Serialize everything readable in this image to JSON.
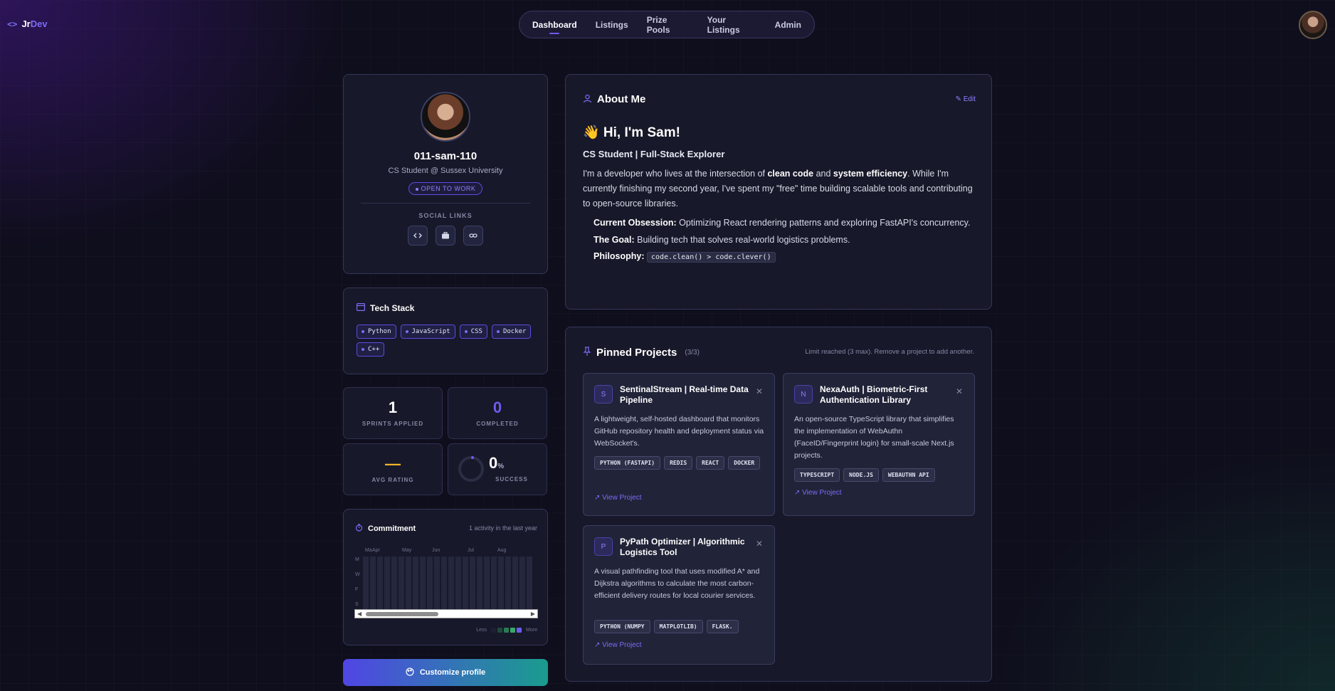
{
  "brand": {
    "jr": "Jr",
    "dev": "Dev",
    "icon": "code-icon"
  },
  "nav": [
    "Dashboard",
    "Listings",
    "Prize Pools",
    "Your Listings",
    "Admin"
  ],
  "profile": {
    "username": "011-sam-110",
    "headline": "CS Student @ Sussex University",
    "status": "OPEN TO WORK",
    "social_label": "SOCIAL LINKS",
    "social_icons": [
      "code-icon",
      "briefcase-icon",
      "link-icon"
    ]
  },
  "tech": {
    "title": "Tech Stack",
    "items": [
      "Python",
      "JavaScript",
      "CSS",
      "Docker",
      "C++"
    ]
  },
  "stats": [
    {
      "value": "1",
      "label": "SPRINTS APPLIED"
    },
    {
      "value": "0",
      "label": "COMPLETED"
    },
    {
      "value": "—",
      "label": "AVG RATING"
    },
    {
      "value": "0",
      "unit": "%",
      "label": "SUCCESS"
    }
  ],
  "commitment": {
    "title": "Commitment",
    "note": "1 activity in the last year",
    "months": [
      "Ma",
      "Apr",
      "May",
      "Jun",
      "Jul",
      "Aug"
    ],
    "days": [
      "M",
      "W",
      "F",
      "S"
    ],
    "legend_less": "Less",
    "legend_more": "More",
    "legend_colors": [
      "#1d1f33",
      "#1f4a3a",
      "#2a7a55",
      "#3aa86a",
      "#6e5cf0"
    ]
  },
  "customize_label": "Customize profile",
  "about": {
    "title": "About Me",
    "edit": "Edit",
    "greeting": "👋 Hi, I'm Sam!",
    "subtitle": "CS Student | Full-Stack Explorer",
    "para_1": "I'm a developer who lives at the intersection of ",
    "bold_1": "clean code",
    "para_2": " and ",
    "bold_2": "system efficiency",
    "para_3": ". While I'm currently finishing my second year, I've spent my \"free\" time building scalable tools and contributing to open-source libraries.",
    "bullets": [
      {
        "label": "Current Obsession:",
        "text": " Optimizing React rendering patterns and exploring FastAPI's concurrency."
      },
      {
        "label": "The Goal:",
        "text": " Building tech that solves real-world logistics problems."
      },
      {
        "label": "Philosophy:",
        "code": "code.clean() > code.clever()"
      }
    ]
  },
  "pinned": {
    "title": "Pinned Projects",
    "count": "(3/3)",
    "limit": "Limit reached (3 max). Remove a project to add another.",
    "projects": [
      {
        "initial": "S",
        "title": "SentinalStream | Real-time Data Pipeline",
        "desc": "A lightweight, self-hosted dashboard that monitors GitHub repository health and deployment status via WebSocket's.",
        "tags": [
          "PYTHON (FASTAPI)",
          "REDIS",
          "REACT",
          "DOCKER"
        ],
        "link": "View Project"
      },
      {
        "initial": "N",
        "title": "NexaAuth | Biometric-First Authentication Library",
        "desc": "An open-source TypeScript library that simplifies the implementation of WebAuthn (FaceID/Fingerprint login) for small-scale Next.js projects.",
        "tags": [
          "TYPESCRIPT",
          "NODE.JS",
          "WEBAUTHN API"
        ],
        "link": "View Project"
      },
      {
        "initial": "P",
        "title": "PyPath Optimizer | Algorithmic Logistics Tool",
        "desc": "A visual pathfinding tool that uses modified A* and Dijkstra algorithms to calculate the most carbon-efficient delivery routes for local courier services.",
        "tags": [
          "PYTHON (NUMPY",
          "MATPLOTLIB)",
          "FLASK."
        ],
        "link": "View Project"
      }
    ]
  }
}
